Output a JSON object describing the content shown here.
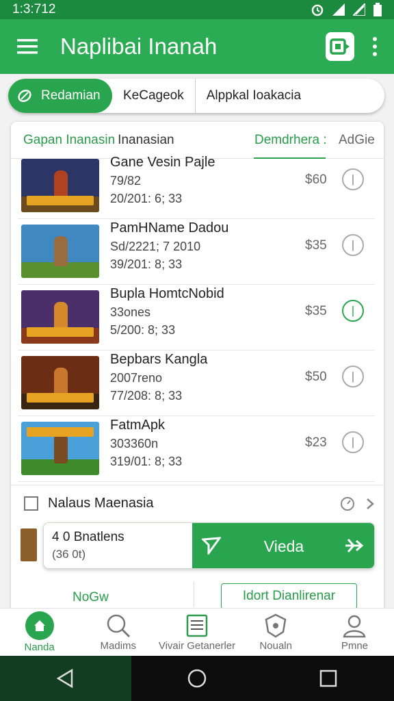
{
  "status_bar": {
    "time": "1:3:712"
  },
  "app_bar": {
    "title": "Naplibai Inanah",
    "menu_icon": "hamburger-icon",
    "logo_icon": "app-logo-icon"
  },
  "filters": [
    {
      "label": "Redamian",
      "active": true
    },
    {
      "label": "KeCageok",
      "active": false
    },
    {
      "label": "Alppkal Ioakacia",
      "active": false
    }
  ],
  "tabs": {
    "first": "Gapan Inanasin",
    "second": "Inanasian",
    "green": "Demdrhera :",
    "grey": "AdGie"
  },
  "games": [
    {
      "title": "Gane Vesin Pajle",
      "line1": "79/82",
      "line2": "20/201: 6; 33",
      "price": "$60",
      "colors": {
        "sky": "#2c3566",
        "ground": "#6b4b1e",
        "hero": "#b0421f"
      }
    },
    {
      "title": "PamHName Dadou",
      "line1": "Sd/2221; 7 2010",
      "line2": "39/201: 8; 33",
      "price": "$35",
      "colors": {
        "sky": "#3f88c0",
        "ground": "#5a8f2d",
        "hero": "#9a6b3d"
      }
    },
    {
      "title": "Bupla HomtcNobid",
      "line1": "33ones",
      "line2": "5/200: 8; 33",
      "price": "$35",
      "colors": {
        "sky": "#4a2f6a",
        "ground": "#8a3a1a",
        "hero": "#d48a2a"
      }
    },
    {
      "title": "Bepbars Kangla",
      "line1": "2007reno",
      "line2": "77/208: 8; 33",
      "price": "$50",
      "colors": {
        "sky": "#6b2d14",
        "ground": "#3a2412",
        "hero": "#c9772c"
      }
    },
    {
      "title": "FatmApk",
      "line1": "303360n",
      "line2": "319/01: 8; 33",
      "price": "$23",
      "colors": {
        "sky": "#4aa0d8",
        "ground": "#3f8a2a",
        "hero": "#7a4a22"
      }
    }
  ],
  "checkbox_row": {
    "label": "Nalaus Maenasia"
  },
  "action_bar": {
    "count": "4 0 Bnatlens",
    "sub": "(36 0t)",
    "button": "Vieda"
  },
  "lower": {
    "left_label": "NoGw",
    "button": "Idort Dianlirenar"
  },
  "bottom_nav": [
    {
      "label": "Nanda",
      "icon": "home-icon",
      "active": true
    },
    {
      "label": "Madims",
      "icon": "search-icon",
      "active": false
    },
    {
      "label": "Vivair Getanerler",
      "icon": "list-icon",
      "active": false
    },
    {
      "label": "Noualn",
      "icon": "shield-icon",
      "active": false
    },
    {
      "label": "Pmne",
      "icon": "profile-icon",
      "active": false
    }
  ]
}
